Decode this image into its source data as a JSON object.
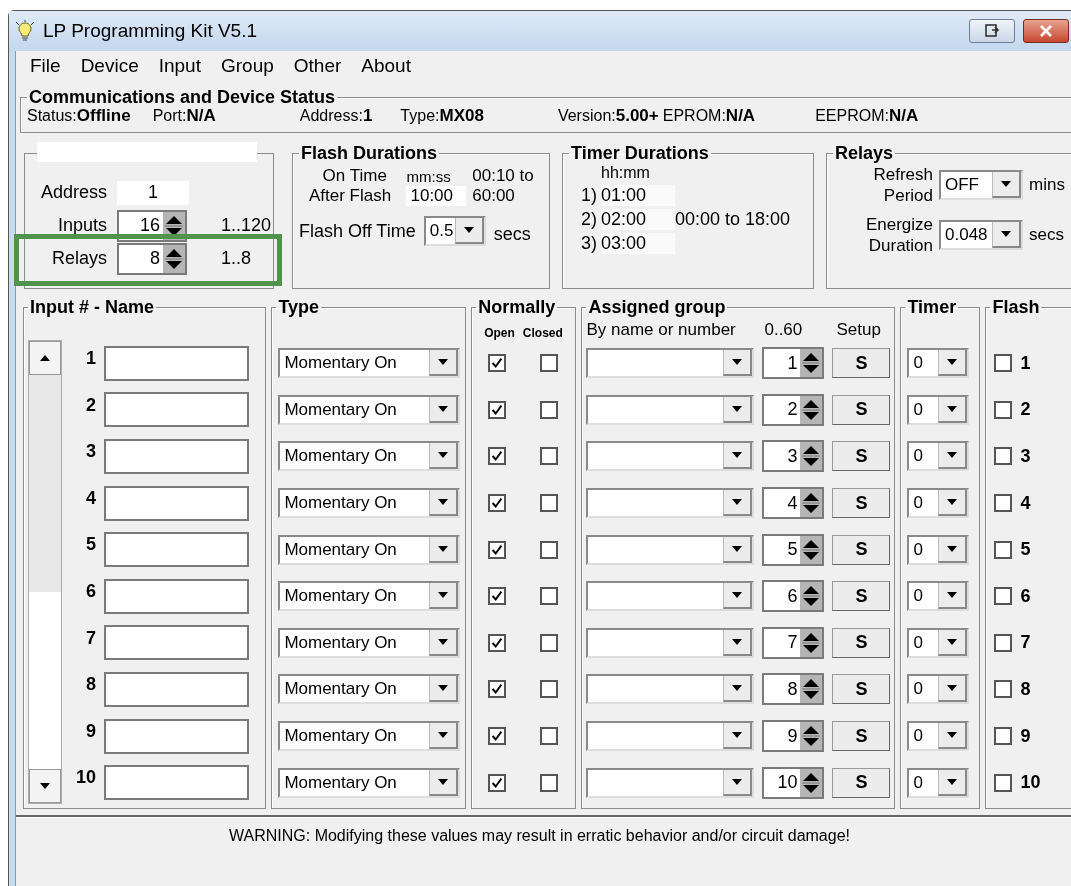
{
  "window": {
    "title": "LP Programming Kit V5.1"
  },
  "menu": [
    "File",
    "Device",
    "Input",
    "Group",
    "Other",
    "About"
  ],
  "status": {
    "title": "Communications and Device Status",
    "fields": [
      {
        "label": "Status:",
        "value": "Offline"
      },
      {
        "label": "Port:",
        "value": "N/A"
      },
      {
        "label": "Address:",
        "value": "1"
      },
      {
        "label": "Type:",
        "value": "MX08"
      },
      {
        "label": "Version:",
        "value": "5.00+"
      },
      {
        "label": "EPROM:",
        "value": "N/A"
      },
      {
        "label": "EEPROM:",
        "value": "N/A"
      }
    ]
  },
  "device": {
    "address": {
      "label": "Address",
      "value": "1"
    },
    "inputs": {
      "label": "Inputs",
      "value": "16",
      "range": "1..120"
    },
    "relays": {
      "label": "Relays",
      "value": "8",
      "range": "1..8",
      "highlighted": true
    }
  },
  "flash_durations": {
    "title": "Flash Durations",
    "on_time_label": "On Time",
    "after_flash_label": "After Flash",
    "unit": "mm:ss",
    "value": "10:00",
    "range_from": "00:10 to",
    "range_to": "60:00",
    "off_label": "Flash Off Time",
    "off_value": "0.5",
    "off_unit": "secs"
  },
  "timer_durations": {
    "title": "Timer Durations",
    "unit": "hh:mm",
    "range": "00:00 to 18:00",
    "timers": [
      {
        "label": "1)",
        "value": "01:00"
      },
      {
        "label": "2)",
        "value": "02:00"
      },
      {
        "label": "3)",
        "value": "03:00"
      }
    ]
  },
  "relays": {
    "title": "Relays",
    "refresh_label": [
      "Refresh",
      "Period"
    ],
    "refresh_value": "OFF",
    "refresh_unit": "mins",
    "energize_label": [
      "Energize",
      "Duration"
    ],
    "energize_value": "0.048",
    "energize_unit": "secs"
  },
  "table": {
    "headers": {
      "input": "Input # - Name",
      "type": "Type",
      "normally": "Normally",
      "open": "Open",
      "closed": "Closed",
      "group": "Assigned group",
      "by_name": "By name or number",
      "range": "0..60",
      "setup": "Setup",
      "timer": "Timer",
      "flash": "Flash"
    },
    "rows": [
      {
        "number": "1",
        "type": "Momentary On",
        "open": true,
        "closed": false,
        "group_number": "1",
        "setup": "S",
        "timer": "0",
        "flash": false,
        "flash_label": "1"
      },
      {
        "number": "2",
        "type": "Momentary On",
        "open": true,
        "closed": false,
        "group_number": "2",
        "setup": "S",
        "timer": "0",
        "flash": false,
        "flash_label": "2"
      },
      {
        "number": "3",
        "type": "Momentary On",
        "open": true,
        "closed": false,
        "group_number": "3",
        "setup": "S",
        "timer": "0",
        "flash": false,
        "flash_label": "3"
      },
      {
        "number": "4",
        "type": "Momentary On",
        "open": true,
        "closed": false,
        "group_number": "4",
        "setup": "S",
        "timer": "0",
        "flash": false,
        "flash_label": "4"
      },
      {
        "number": "5",
        "type": "Momentary On",
        "open": true,
        "closed": false,
        "group_number": "5",
        "setup": "S",
        "timer": "0",
        "flash": false,
        "flash_label": "5"
      },
      {
        "number": "6",
        "type": "Momentary On",
        "open": true,
        "closed": false,
        "group_number": "6",
        "setup": "S",
        "timer": "0",
        "flash": false,
        "flash_label": "6"
      },
      {
        "number": "7",
        "type": "Momentary On",
        "open": true,
        "closed": false,
        "group_number": "7",
        "setup": "S",
        "timer": "0",
        "flash": false,
        "flash_label": "7"
      },
      {
        "number": "8",
        "type": "Momentary On",
        "open": true,
        "closed": false,
        "group_number": "8",
        "setup": "S",
        "timer": "0",
        "flash": false,
        "flash_label": "8"
      },
      {
        "number": "9",
        "type": "Momentary On",
        "open": true,
        "closed": false,
        "group_number": "9",
        "setup": "S",
        "timer": "0",
        "flash": false,
        "flash_label": "9"
      },
      {
        "number": "10",
        "type": "Momentary On",
        "open": true,
        "closed": false,
        "group_number": "10",
        "setup": "S",
        "timer": "0",
        "flash": false,
        "flash_label": "10"
      }
    ]
  },
  "warning": "WARNING: Modifying these values may result in erratic behavior and/or circuit damage!"
}
